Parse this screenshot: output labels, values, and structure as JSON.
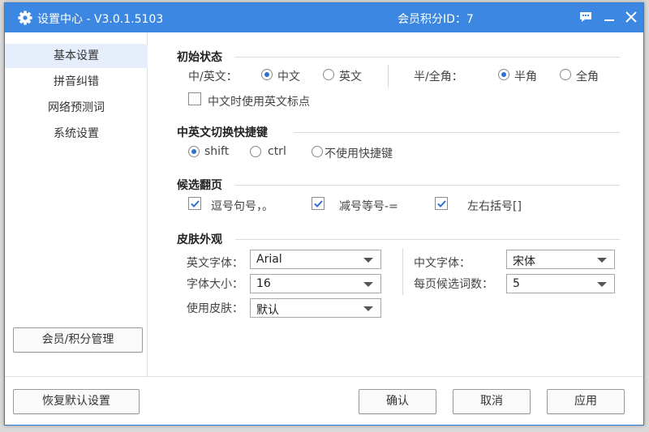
{
  "window": {
    "title": "设置中心 - V3.0.1.5103",
    "member_id": "会员积分ID：7"
  },
  "sidebar": {
    "items": [
      {
        "label": "基本设置"
      },
      {
        "label": "拼音纠错"
      },
      {
        "label": "网络预测词"
      },
      {
        "label": "系统设置"
      }
    ],
    "member_button": "会员/积分管理"
  },
  "initial_state": {
    "title": "初始状态",
    "lang_label": "中/英文：",
    "lang_options": [
      "中文",
      "英文"
    ],
    "lang_selected": "中文",
    "width_label": "半/全角：",
    "width_options": [
      "半角",
      "全角"
    ],
    "width_selected": "半角",
    "punct_checkbox": "中文时使用英文标点",
    "punct_checked": false
  },
  "hotkey": {
    "title": "中英文切换快捷键",
    "options": [
      "shift",
      "ctrl",
      "不使用快捷键"
    ],
    "selected": "shift"
  },
  "paging": {
    "title": "候选翻页",
    "options": [
      {
        "label": "逗号句号，。",
        "checked": true
      },
      {
        "label": "减号等号-=",
        "checked": true
      },
      {
        "label": "左右括号[]",
        "checked": true
      }
    ]
  },
  "skin": {
    "title": "皮肤外观",
    "en_font_label": "英文字体：",
    "en_font_value": "Arial",
    "font_size_label": "字体大小：",
    "font_size_value": "16",
    "skin_label": "使用皮肤：",
    "skin_value": "默认",
    "cn_font_label": "中文字体：",
    "cn_font_value": "宋体",
    "candidates_label": "每页候选词数：",
    "candidates_value": "5"
  },
  "footer": {
    "restore_button": "恢复默认设置",
    "ok_button": "确认",
    "cancel_button": "取消",
    "apply_button": "应用"
  },
  "colors": {
    "titlebar": "#3b87e1",
    "accent": "#2e6fd2",
    "sidebar_active": "#e6eefb"
  }
}
